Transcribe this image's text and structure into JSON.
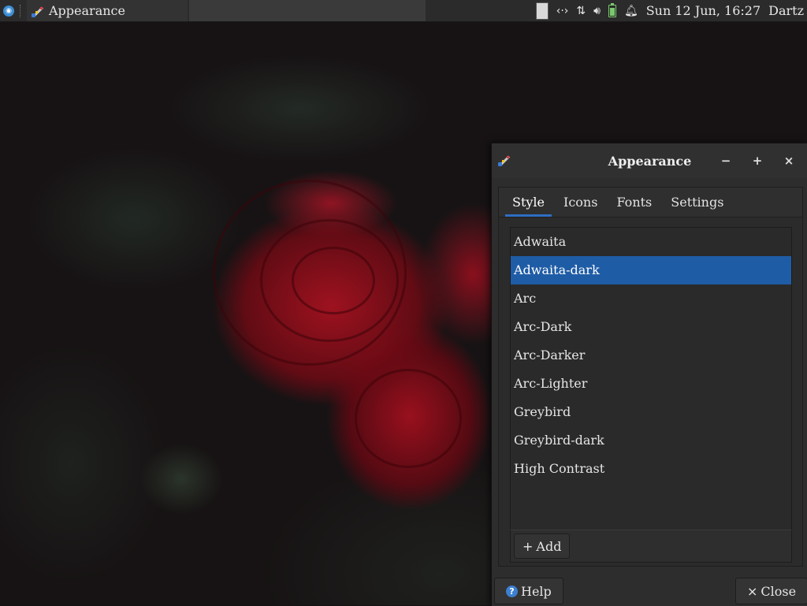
{
  "panel": {
    "task_title": "Appearance",
    "clock": "Sun 12 Jun, 16:27",
    "user": "Dartz",
    "tray_icons": [
      "workspace-icon",
      "network-arrows-icon",
      "transfer-icon",
      "volume-icon",
      "battery-icon",
      "notification-bell-icon"
    ]
  },
  "dialog": {
    "title": "Appearance",
    "window_controls": {
      "minimize": "−",
      "maximize": "+",
      "close": "×"
    },
    "tabs": [
      {
        "label": "Style",
        "active": true
      },
      {
        "label": "Icons",
        "active": false
      },
      {
        "label": "Fonts",
        "active": false
      },
      {
        "label": "Settings",
        "active": false
      }
    ],
    "themes": [
      {
        "label": "Adwaita",
        "selected": false
      },
      {
        "label": "Adwaita-dark",
        "selected": true
      },
      {
        "label": "Arc",
        "selected": false
      },
      {
        "label": "Arc-Dark",
        "selected": false
      },
      {
        "label": "Arc-Darker",
        "selected": false
      },
      {
        "label": "Arc-Lighter",
        "selected": false
      },
      {
        "label": "Greybird",
        "selected": false
      },
      {
        "label": "Greybird-dark",
        "selected": false
      },
      {
        "label": "High Contrast",
        "selected": false
      }
    ],
    "add_label": "Add",
    "help_label": "Help",
    "close_label": "Close"
  },
  "colors": {
    "selection": "#1f5ca6",
    "tab_indicator": "#2e6ec4",
    "panel_bg": "#2b2b2b",
    "dialog_bg": "#2d2d2d"
  }
}
